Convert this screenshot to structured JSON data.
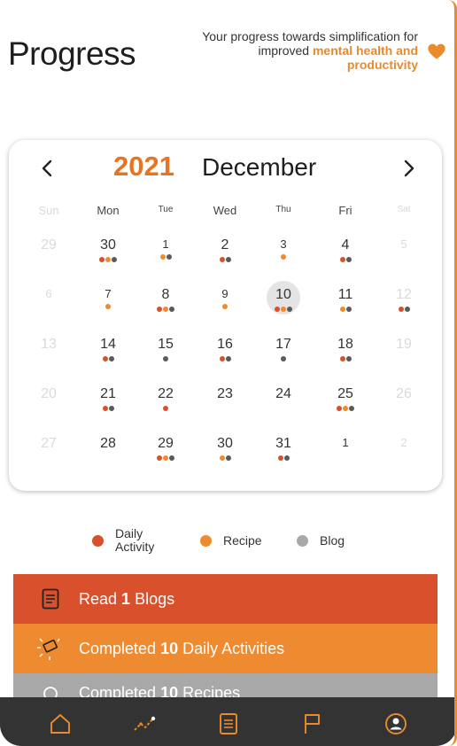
{
  "header": {
    "title": "Progress",
    "tagline_plain": "Your progress towards simplification for improved",
    "tagline_highlight": "mental health and productivity"
  },
  "calendar": {
    "year": "2021",
    "month": "December",
    "weekdays": [
      "Sun",
      "Mon",
      "Tue",
      "Wed",
      "Thu",
      "Fri",
      "Sat"
    ],
    "weeks": [
      [
        {
          "d": "29",
          "muted": true,
          "dots": []
        },
        {
          "d": "30",
          "dots": [
            "a",
            "r",
            "b"
          ]
        },
        {
          "d": "1",
          "small": true,
          "dots": [
            "r",
            "b"
          ]
        },
        {
          "d": "2",
          "dots": [
            "a",
            "b"
          ]
        },
        {
          "d": "3",
          "small": true,
          "dots": [
            "r"
          ]
        },
        {
          "d": "4",
          "dots": [
            "a",
            "b"
          ]
        },
        {
          "d": "5",
          "muted": true,
          "small": true,
          "dots": []
        }
      ],
      [
        {
          "d": "6",
          "muted": true,
          "small": true,
          "dots": []
        },
        {
          "d": "7",
          "small": true,
          "dots": [
            "r"
          ]
        },
        {
          "d": "8",
          "dots": [
            "a",
            "r",
            "b"
          ]
        },
        {
          "d": "9",
          "small": true,
          "dots": [
            "r"
          ]
        },
        {
          "d": "10",
          "selected": true,
          "dots": [
            "a",
            "r",
            "b"
          ]
        },
        {
          "d": "11",
          "dots": [
            "r",
            "b"
          ]
        },
        {
          "d": "12",
          "muted": true,
          "dots": [
            "a",
            "b"
          ]
        }
      ],
      [
        {
          "d": "13",
          "muted": true,
          "dots": []
        },
        {
          "d": "14",
          "dots": [
            "a",
            "b"
          ]
        },
        {
          "d": "15",
          "dots": [
            "b"
          ]
        },
        {
          "d": "16",
          "dots": [
            "a",
            "b"
          ]
        },
        {
          "d": "17",
          "dots": [
            "b"
          ]
        },
        {
          "d": "18",
          "dots": [
            "a",
            "b"
          ]
        },
        {
          "d": "19",
          "muted": true,
          "dots": []
        }
      ],
      [
        {
          "d": "20",
          "muted": true,
          "dots": []
        },
        {
          "d": "21",
          "dots": [
            "a",
            "b"
          ]
        },
        {
          "d": "22",
          "dots": [
            "a"
          ]
        },
        {
          "d": "23",
          "dots": []
        },
        {
          "d": "24",
          "dots": []
        },
        {
          "d": "25",
          "dots": [
            "a",
            "r",
            "b"
          ]
        },
        {
          "d": "26",
          "muted": true,
          "dots": []
        }
      ],
      [
        {
          "d": "27",
          "muted": true,
          "dots": []
        },
        {
          "d": "28",
          "dots": []
        },
        {
          "d": "29",
          "dots": [
            "a",
            "r",
            "b"
          ]
        },
        {
          "d": "30",
          "dots": [
            "r",
            "b"
          ]
        },
        {
          "d": "31",
          "dots": [
            "a",
            "b"
          ]
        },
        {
          "d": "1",
          "small": true,
          "dots": []
        },
        {
          "d": "2",
          "muted": true,
          "small": true,
          "dots": []
        }
      ]
    ]
  },
  "legend": {
    "daily_activity": "Daily\nActivity",
    "recipe": "Recipe",
    "blog": "Blog"
  },
  "summary": {
    "blogs": {
      "pre": "Read ",
      "num": "1",
      "post": " Blogs"
    },
    "activities": {
      "pre": "Completed ",
      "num": "10",
      "post": " Daily Activities"
    },
    "recipes": {
      "pre": "Completed ",
      "num": "10",
      "post": " Recipes"
    }
  },
  "colors": {
    "accent": "#e98a2c",
    "daily_activity": "#d9502c",
    "recipe": "#ee8a30",
    "blog": "#5a5a5a",
    "nav_bg": "#333333"
  },
  "icons": {
    "nav": [
      "home-icon",
      "trend-icon",
      "list-icon",
      "flag-icon",
      "profile-icon"
    ]
  }
}
